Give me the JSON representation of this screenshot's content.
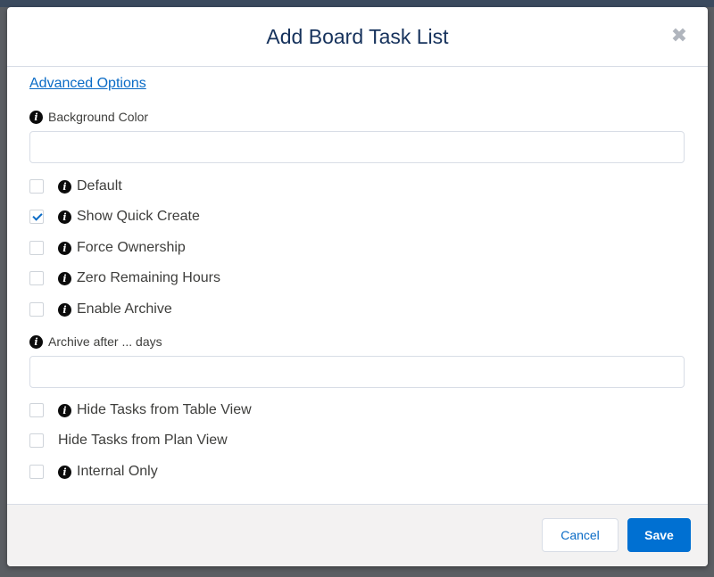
{
  "modal": {
    "title": "Add Board Task List",
    "close_icon": "close-icon"
  },
  "body": {
    "advanced_options_link": "Advanced Options",
    "background_color": {
      "label": "Background Color",
      "value": ""
    },
    "checkboxes_top": [
      {
        "label": "Default",
        "checked": false,
        "info_icon": true
      },
      {
        "label": "Show Quick Create",
        "checked": true,
        "info_icon": true
      },
      {
        "label": "Force Ownership",
        "checked": false,
        "info_icon": true
      },
      {
        "label": "Zero Remaining Hours",
        "checked": false,
        "info_icon": true
      },
      {
        "label": "Enable Archive",
        "checked": false,
        "info_icon": true
      }
    ],
    "archive_after": {
      "label": "Archive after ... days",
      "value": ""
    },
    "checkboxes_bottom": [
      {
        "label": "Hide Tasks from Table View",
        "checked": false,
        "info_icon": true
      },
      {
        "label": "Hide Tasks from Plan View",
        "checked": false,
        "info_icon": false
      },
      {
        "label": "Internal Only",
        "checked": false,
        "info_icon": true
      }
    ]
  },
  "footer": {
    "cancel_label": "Cancel",
    "save_label": "Save"
  },
  "colors": {
    "accent": "#0070d2",
    "link": "#0a6bc6",
    "backdrop": "#5b5e63"
  }
}
